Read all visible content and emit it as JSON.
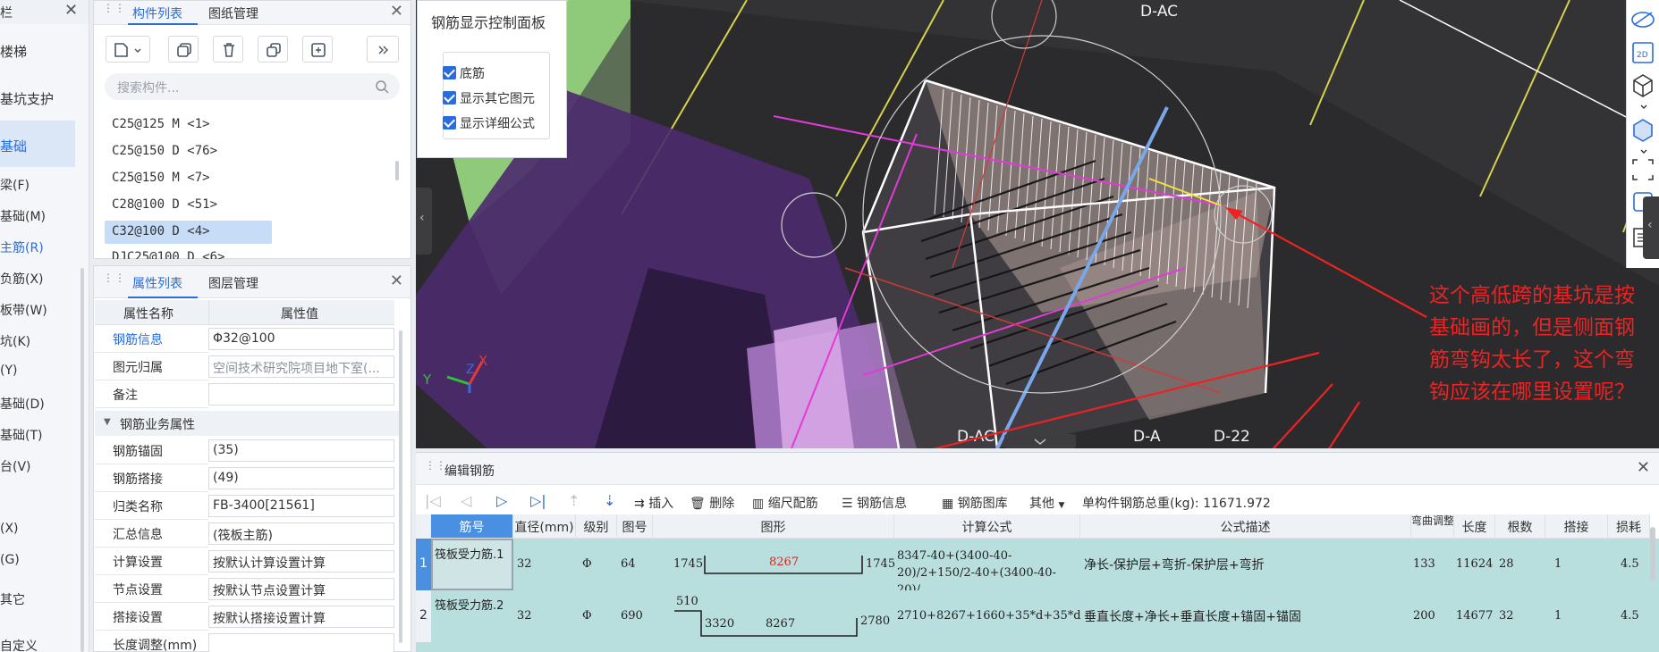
{
  "left_nav": {
    "header": "栏",
    "items": [
      "楼梯",
      "基坑支护",
      "基础"
    ],
    "sub_items": [
      "梁(F)",
      "基础(M)",
      "主筋(R)",
      "负筋(X)",
      "板带(W)",
      "坑(K)",
      "(Y)",
      "基础(D)",
      "基础(T)",
      "台(V)",
      "(X)",
      "(G)",
      "其它",
      "自定义"
    ]
  },
  "component_panel": {
    "tab_active": "构件列表",
    "tab_other": "图纸管理",
    "search_placeholder": "搜索构件...",
    "items": [
      "C25@125 M <1>",
      "C25@150 D <76>",
      "C25@150 M <7>",
      "C28@100 D <51>",
      "C32@100 D <4>",
      "DJC25@100 D <6>"
    ],
    "selected_index": 4
  },
  "property_panel": {
    "tab_active": "属性列表",
    "tab_other": "图层管理",
    "col_name": "属性名称",
    "col_value": "属性值",
    "rows": [
      {
        "name": "钢筋信息",
        "value": "Φ32@100",
        "link": true,
        "gray": false
      },
      {
        "name": "图元归属",
        "value": "空间技术研究院项目地下室(...",
        "link": false,
        "gray": true
      },
      {
        "name": "备注",
        "value": "",
        "link": false,
        "gray": false
      }
    ],
    "group": "钢筋业务属性",
    "group_rows": [
      {
        "name": "钢筋锚固",
        "value": "(35)"
      },
      {
        "name": "钢筋搭接",
        "value": "(49)"
      },
      {
        "name": "归类名称",
        "value": "FB-3400[21561]"
      },
      {
        "name": "汇总信息",
        "value": "(筏板主筋)"
      },
      {
        "name": "计算设置",
        "value": "按默认计算设置计算"
      },
      {
        "name": "节点设置",
        "value": "按默认节点设置计算"
      },
      {
        "name": "搭接设置",
        "value": "按默认搭接设置计算"
      },
      {
        "name": "长度调整(mm)",
        "value": ""
      }
    ]
  },
  "control_panel": {
    "title": "钢筋显示控制面板",
    "checks": [
      "底筋",
      "显示其它图元",
      "显示详细公式"
    ]
  },
  "viewport": {
    "axis_labels": [
      "D-AC",
      "D-AC",
      "D-A",
      "D-22"
    ],
    "axis_letters": {
      "x": "X",
      "y": "Y",
      "z": "Z"
    }
  },
  "annotation": "这个高低跨的基坑是按基础画的，但是侧面钢筋弯钩太长了，这个弯钩应该在哪里设置呢？",
  "edit_panel": {
    "title": "编辑钢筋",
    "toolbar": {
      "insert": "插入",
      "delete": "删除",
      "scale_rebar": "缩尺配筋",
      "rebar_info": "钢筋信息",
      "rebar_library": "钢筋图库",
      "other": "其他",
      "total_label": "单构件钢筋总重(kg):",
      "total_value": "11671.972"
    },
    "columns": [
      "筋号",
      "直径(mm)",
      "级别",
      "图号",
      "图形",
      "计算公式",
      "公式描述",
      "弯曲调整",
      "长度",
      "根数",
      "搭接",
      "损耗"
    ],
    "rows": [
      {
        "num": "1",
        "name": "筏板受力筋.1",
        "diameter": "32",
        "grade": "Φ",
        "fig_no": "64",
        "shape_left": "1745",
        "shape_mid": "8267",
        "shape_right": "1745",
        "formula": "8347-40+(3400-40-20)/2+150/2-40+(3400-40-20)/...",
        "description": "净长-保护层+弯折-保护层+弯折",
        "bend_adjust": "133",
        "length": "11624",
        "count": "28",
        "lap": "1",
        "loss": "4.5"
      },
      {
        "num": "2",
        "name": "筏板受力筋.2",
        "diameter": "32",
        "grade": "Φ",
        "fig_no": "690",
        "shape_top": "510",
        "shape_left": "3320",
        "shape_mid": "8267",
        "shape_right": "2780",
        "formula": "2710+8267+1660+35*d+35*d",
        "description": "垂直长度+净长+垂直长度+锚固+锚固",
        "bend_adjust": "200",
        "length": "14677",
        "count": "32",
        "lap": "1",
        "loss": "4.5"
      }
    ]
  },
  "colors": {
    "accent": "#2a6cd9",
    "annotation": "#ee2222",
    "row_bg": "#b9dede",
    "viewport_bg": "#262628"
  }
}
